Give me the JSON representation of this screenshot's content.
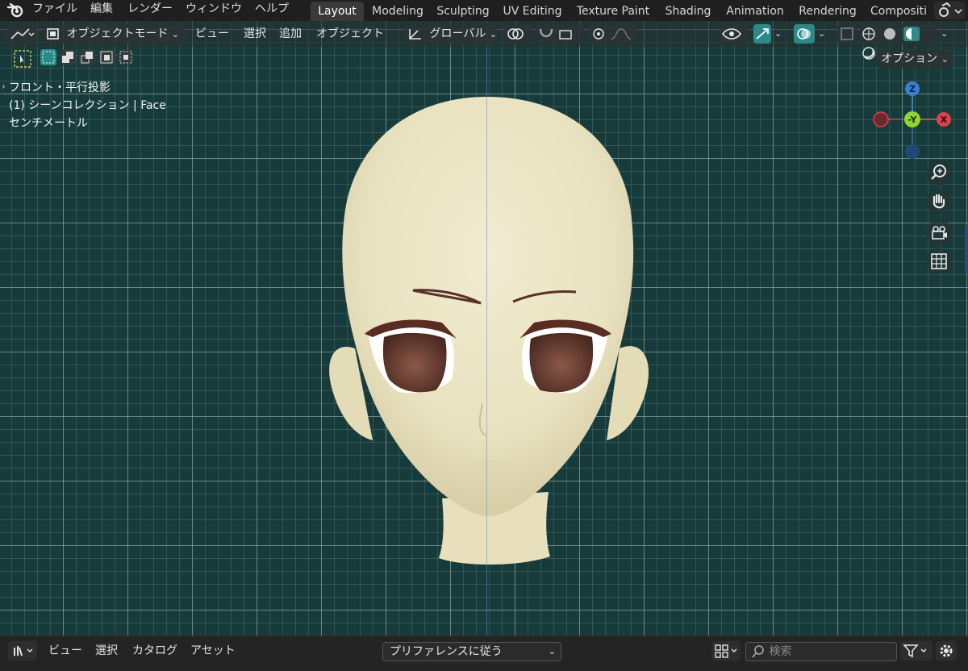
{
  "topbar": {
    "menus": [
      "ファイル",
      "編集",
      "レンダー",
      "ウィンドウ",
      "ヘルプ"
    ],
    "workspace_tabs": [
      "Layout",
      "Modeling",
      "Sculpting",
      "UV Editing",
      "Texture Paint",
      "Shading",
      "Animation",
      "Rendering",
      "Compositi"
    ],
    "active_tab": "Layout"
  },
  "viewport_header": {
    "mode_label": "オブジェクトモード",
    "menus": [
      "ビュー",
      "選択",
      "追加",
      "オブジェクト"
    ],
    "transform_orientation": "グローバル",
    "options_label": "オプション"
  },
  "viewport_overlay": {
    "view_name": "フロント・平行投影",
    "collection_info": "(1) シーンコレクション | Face",
    "units": "センチメートル"
  },
  "gizmo": {
    "z_label": "Z",
    "y_label": "-Y",
    "x_label": "X"
  },
  "colors": {
    "viewport_bg": "#173b3b",
    "accent_teal": "#2a8a8a",
    "axis_x": "#d9434b",
    "axis_y": "#8fd630",
    "axis_z": "#3a7fd0",
    "skin": "#ece6c8"
  },
  "bottombar": {
    "menus": [
      "ビュー",
      "選択",
      "カタログ",
      "アセット"
    ],
    "dropdown_label": "プリファレンスに従う",
    "search_placeholder": "検索"
  }
}
